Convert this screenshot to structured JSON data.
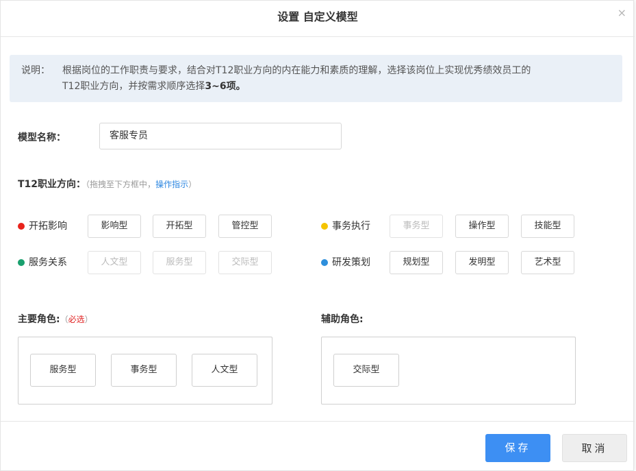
{
  "dialog": {
    "title": "设置 自定义模型",
    "close_symbol": "×"
  },
  "note": {
    "label": "说明：",
    "line1": "根据岗位的工作职责与要求，结合对T12职业方向的内在能力和素质的理解，选择该岗位上实现优秀绩效员工的",
    "line2_prefix": "T12职业方向，并按需求顺序选择",
    "line2_bold": "3~6项。"
  },
  "model_name": {
    "label": "模型名称：",
    "value": "客服专员"
  },
  "direction": {
    "label": "T12职业方向：",
    "hint_open": "（拖拽至下方框中，",
    "hint_link": "操作指示",
    "hint_close": "）"
  },
  "groups": [
    {
      "name": "开拓影响",
      "color": "#e8231c",
      "tags": [
        {
          "label": "影响型",
          "used": false
        },
        {
          "label": "开拓型",
          "used": false
        },
        {
          "label": "管控型",
          "used": false
        }
      ]
    },
    {
      "name": "事务执行",
      "color": "#f5c400",
      "tags": [
        {
          "label": "事务型",
          "used": true
        },
        {
          "label": "操作型",
          "used": false
        },
        {
          "label": "技能型",
          "used": false
        }
      ]
    },
    {
      "name": "服务关系",
      "color": "#1aa06e",
      "tags": [
        {
          "label": "人文型",
          "used": true
        },
        {
          "label": "服务型",
          "used": true
        },
        {
          "label": "交际型",
          "used": true
        }
      ]
    },
    {
      "name": "研发策划",
      "color": "#2e8fdc",
      "tags": [
        {
          "label": "规划型",
          "used": false
        },
        {
          "label": "发明型",
          "used": false
        },
        {
          "label": "艺术型",
          "used": false
        }
      ]
    }
  ],
  "primary": {
    "label": "主要角色:",
    "hint_open": "（",
    "hint_req": "必选",
    "hint_close": "）",
    "chips": [
      "服务型",
      "事务型",
      "人文型"
    ]
  },
  "secondary": {
    "label": "辅助角色:",
    "chips": [
      "交际型"
    ]
  },
  "footer": {
    "save_label": "保存",
    "cancel_label": "取消"
  }
}
